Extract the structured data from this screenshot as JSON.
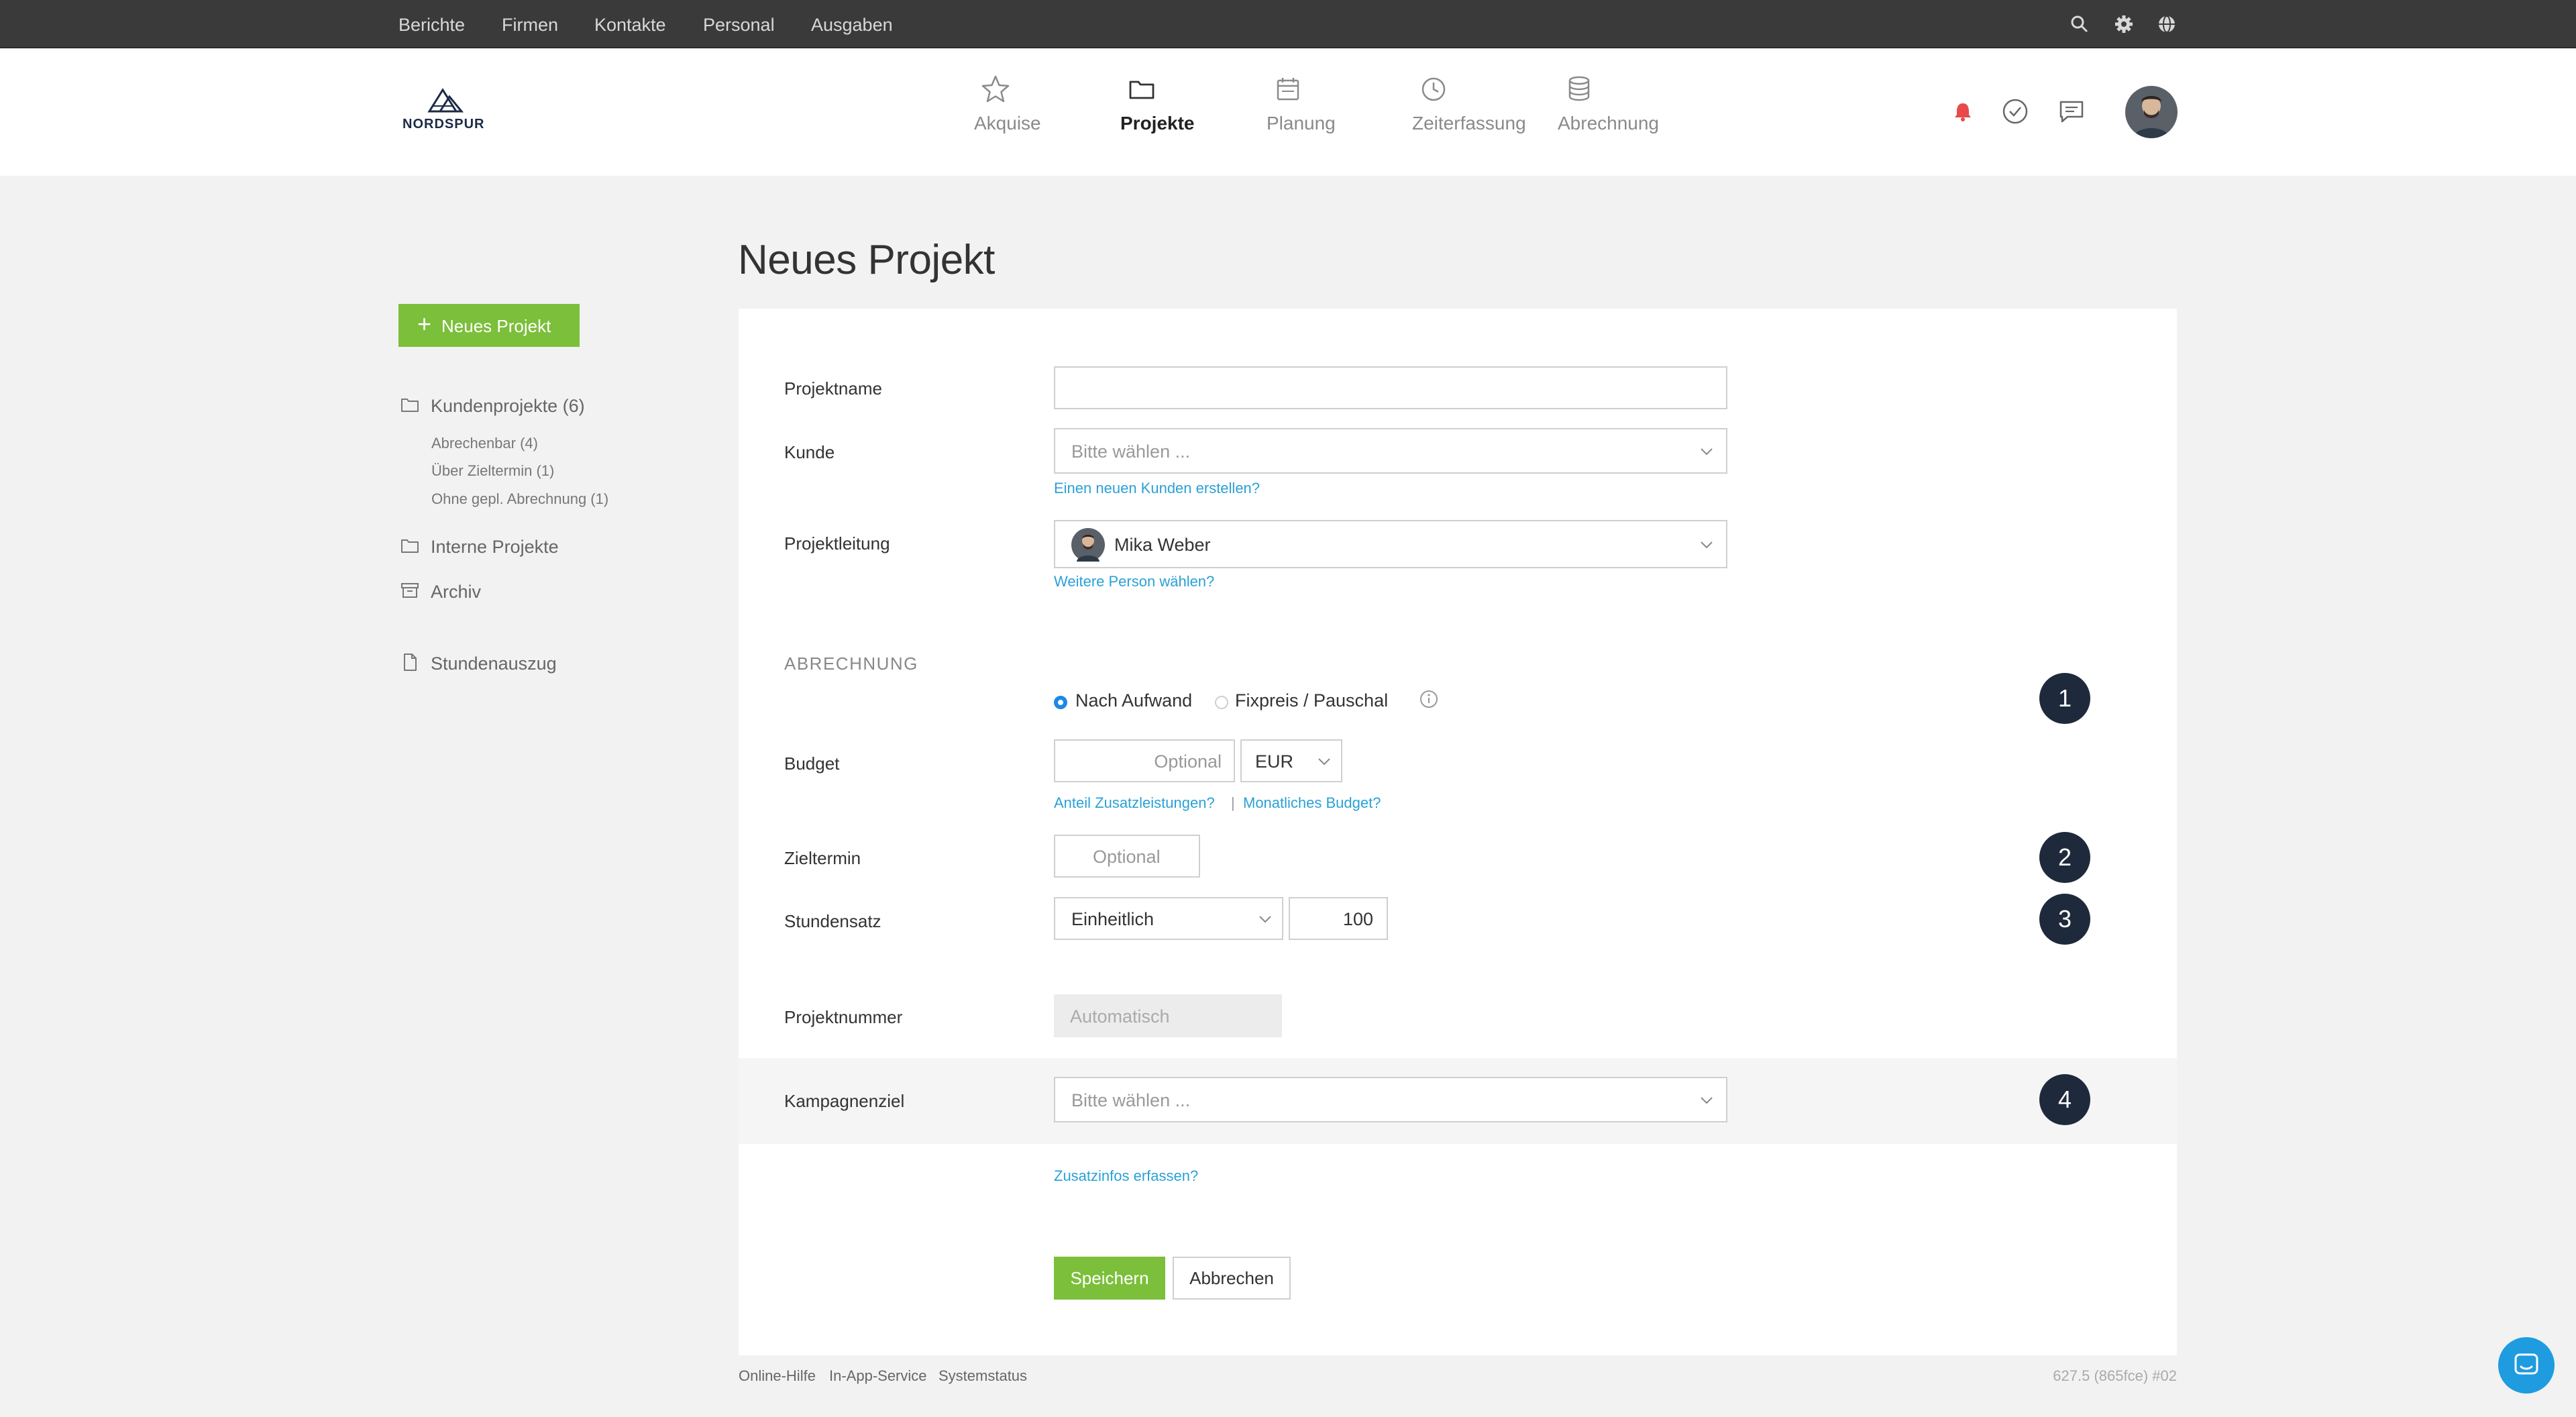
{
  "topbar": {
    "items": [
      "Berichte",
      "Firmen",
      "Kontakte",
      "Personal",
      "Ausgaben"
    ],
    "icons": [
      "search-icon",
      "gear-icon",
      "globe-icon"
    ]
  },
  "header": {
    "logo_text": "NORDSPUR",
    "nav": [
      {
        "label": "Akquise",
        "icon": "star-icon"
      },
      {
        "label": "Projekte",
        "icon": "folder-icon",
        "active": true
      },
      {
        "label": "Planung",
        "icon": "calendar-icon"
      },
      {
        "label": "Zeiterfassung",
        "icon": "clock-icon"
      },
      {
        "label": "Abrechnung",
        "icon": "database-icon"
      }
    ],
    "icons": [
      "bell-icon",
      "check-circle-icon",
      "chat-icon"
    ],
    "colors": {
      "bell": "#e84a4a"
    }
  },
  "sidebar": {
    "new_button": "Neues Projekt",
    "groups": [
      {
        "label": "Kundenprojekte (6)",
        "icon": "folder-icon"
      },
      {
        "label": "Interne Projekte",
        "icon": "folder-icon"
      },
      {
        "label": "Archiv",
        "icon": "archive-icon"
      },
      {
        "label": "Stundenauszug",
        "icon": "document-icon"
      }
    ],
    "subitems": [
      "Abrechenbar (4)",
      "Über Zieltermin (1)",
      "Ohne gepl. Abrechnung (1)"
    ]
  },
  "main": {
    "title": "Neues Projekt",
    "form": {
      "projektname": {
        "label": "Projektname",
        "value": ""
      },
      "kunde": {
        "label": "Kunde",
        "placeholder": "Bitte wählen ...",
        "link": "Einen neuen Kunden erstellen?"
      },
      "projektleitung": {
        "label": "Projektleitung",
        "value": "Mika Weber",
        "link": "Weitere Person wählen?"
      },
      "section_abrechnung": "ABRECHNUNG",
      "billing_type": {
        "option1": "Nach Aufwand",
        "option2": "Fixpreis / Pauschal",
        "selected": "Nach Aufwand"
      },
      "budget": {
        "label": "Budget",
        "placeholder": "Optional",
        "currency": "EUR",
        "link1": "Anteil Zusatzleistungen?",
        "separator": "|",
        "link2": "Monatliches Budget?"
      },
      "zieltermin": {
        "label": "Zieltermin",
        "placeholder": "Optional"
      },
      "stundensatz": {
        "label": "Stundensatz",
        "type": "Einheitlich",
        "value": "100"
      },
      "projektnummer": {
        "label": "Projektnummer",
        "placeholder": "Automatisch"
      },
      "kampagnenziel": {
        "label": "Kampagnenziel",
        "placeholder": "Bitte wählen ..."
      },
      "zusatzinfos_link": "Zusatzinfos erfassen?",
      "save": "Speichern",
      "cancel": "Abbrechen"
    },
    "badges": [
      "1",
      "2",
      "3",
      "4"
    ]
  },
  "footer": {
    "links": [
      "Online-Hilfe",
      "In-App-Service",
      "Systemstatus"
    ],
    "version": "627.5 (865fce) #02"
  },
  "colors": {
    "accent_green": "#7bbf3a",
    "link_blue": "#2aa1d6",
    "badge_navy": "#1e2a3c",
    "radio_blue": "#1e88e5",
    "chat_blue": "#1f9be0"
  }
}
